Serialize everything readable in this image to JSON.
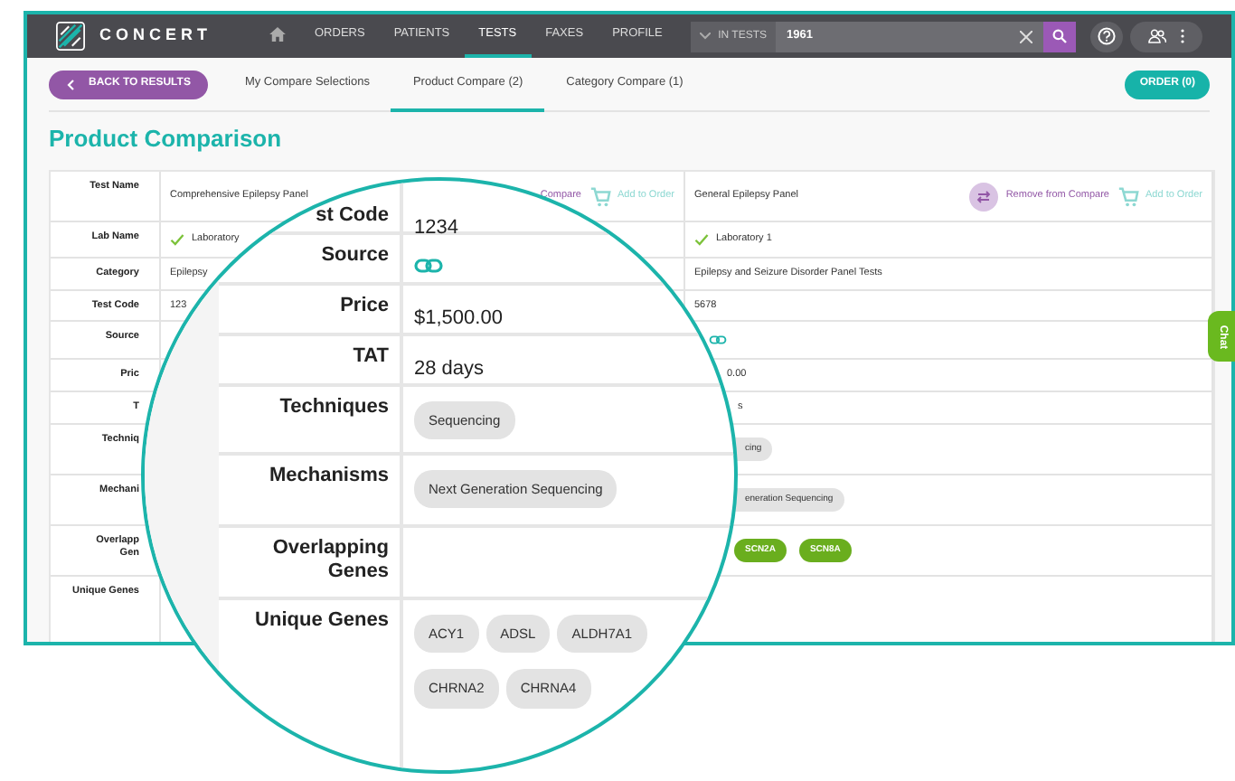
{
  "navbar": {
    "brand": "CONCERT",
    "items": [
      {
        "label": "ORDERS",
        "selected": false
      },
      {
        "label": "PATIENTS",
        "selected": false
      },
      {
        "label": "TESTS",
        "selected": true
      },
      {
        "label": "FAXES",
        "selected": false
      },
      {
        "label": "PROFILE",
        "selected": false
      }
    ],
    "search": {
      "scope": "IN TESTS",
      "value": "1961"
    }
  },
  "subnav": {
    "back_button": "BACK TO RESULTS",
    "tabs": [
      {
        "label": "My Compare Selections",
        "selected": false
      },
      {
        "label": "Product Compare (2)",
        "selected": true
      },
      {
        "label": "Category Compare (1)",
        "selected": false
      }
    ],
    "order_button": "ORDER (0)"
  },
  "title": "Product Comparison",
  "comparison": {
    "rows": [
      {
        "label": "Test Name",
        "kind": "name"
      },
      {
        "label": "Lab Name",
        "kind": "lab"
      },
      {
        "label": "Category",
        "kind": "category"
      },
      {
        "label": "Test Code",
        "kind": "test_code"
      },
      {
        "label": "Source",
        "kind": "source"
      },
      {
        "label": "Pric",
        "kind": "price"
      },
      {
        "label": "T",
        "kind": "tat"
      },
      {
        "label": "Techniq",
        "kind": "techniques"
      },
      {
        "label": "Mechani",
        "kind": "mechanisms"
      },
      {
        "label_lines": [
          "Overlapp",
          "Gen"
        ],
        "kind": "overlapping_genes"
      },
      {
        "label": "Unique Genes",
        "kind": "unique_genes"
      }
    ],
    "products": [
      {
        "name": "Comprehensive Epilepsy Panel",
        "remove_icon": false,
        "remove_label": "Compare",
        "add_label": "Add to Order",
        "verified": true,
        "lab": "Laboratory",
        "category": "Epilepsy",
        "test_code": "123"
      },
      {
        "name": "General Epilepsy Panel",
        "remove_icon": true,
        "remove_label": "Remove from Compare",
        "add_label": "Add to Order",
        "verified": true,
        "lab": "Laboratory 1",
        "category": "Epilepsy and Seizure Disorder Panel Tests",
        "test_code": "5678",
        "source_link": true,
        "price": "0.00",
        "tat": "s",
        "techniques": [
          "cing"
        ],
        "mechanisms": [
          "eneration Sequencing"
        ],
        "overlapping_genes": [
          "SCN2A",
          "SCN8A"
        ]
      }
    ]
  },
  "magnifier": {
    "rows": [
      {
        "label": "st Code",
        "kind": "text",
        "value": "1234"
      },
      {
        "label": "Source",
        "kind": "link"
      },
      {
        "label": "Price",
        "kind": "text",
        "value": "$1,500.00"
      },
      {
        "label": "TAT",
        "kind": "text",
        "value": "28 days"
      },
      {
        "label": "Techniques",
        "kind": "pills",
        "values": [
          "Sequencing"
        ]
      },
      {
        "label": "Mechanisms",
        "kind": "pills",
        "values": [
          "Next Generation Sequencing"
        ]
      },
      {
        "label": "Overlapping Genes",
        "kind": "pills"
      },
      {
        "label": "Unique Genes",
        "kind": "pills",
        "values": [
          "ACY1",
          "ADSL",
          "ALDH7A1",
          "CHRNA2",
          "CHRNA4"
        ]
      }
    ]
  },
  "chat_tab": "Chat"
}
